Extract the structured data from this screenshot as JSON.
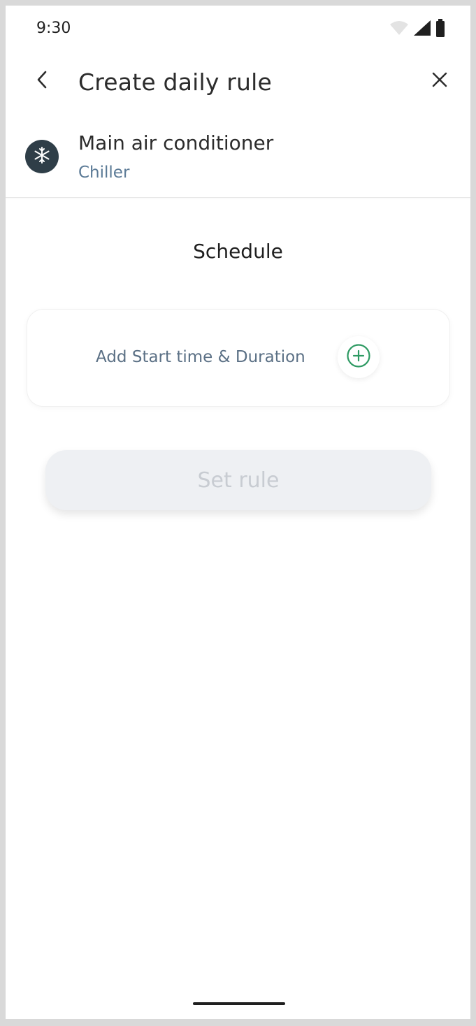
{
  "status_bar": {
    "time": "9:30",
    "icons": [
      "wifi-icon",
      "signal-icon",
      "battery-icon"
    ]
  },
  "app_bar": {
    "title": "Create daily rule",
    "back_icon": "chevron-left-icon",
    "close_icon": "close-icon"
  },
  "device": {
    "name": "Main air conditioner",
    "type": "Chiller",
    "icon": "snowflake-icon"
  },
  "schedule": {
    "title": "Schedule",
    "add_label": "Add Start time & Duration",
    "add_icon": "plus-circle-icon"
  },
  "actions": {
    "set_rule_label": "Set rule",
    "set_rule_disabled": true
  },
  "colors": {
    "accent_green": "#2e9a63",
    "device_icon_bg": "#2f3e48",
    "subtitle_blue": "#5b7a96",
    "disabled_button_bg": "#eef0f3",
    "disabled_button_text": "#c8ccd2"
  }
}
